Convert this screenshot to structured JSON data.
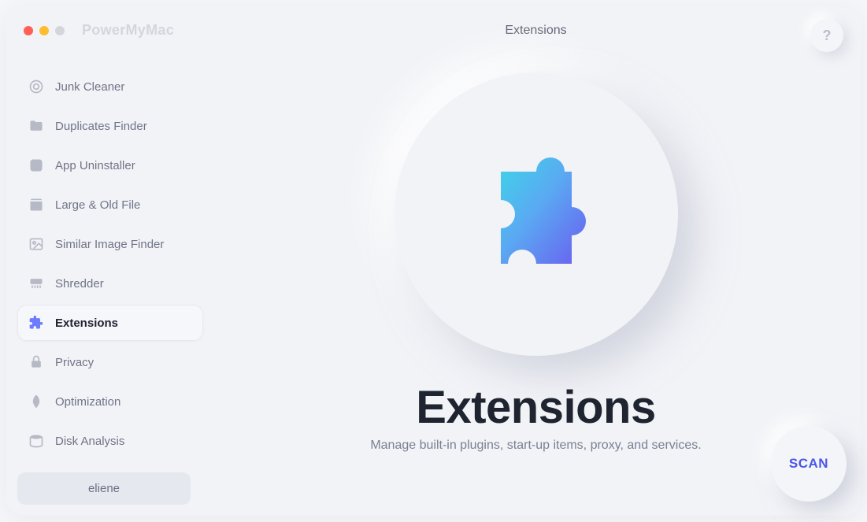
{
  "app": {
    "title": "PowerMyMac"
  },
  "sidebar": {
    "items": [
      {
        "label": "Junk Cleaner"
      },
      {
        "label": "Duplicates Finder"
      },
      {
        "label": "App Uninstaller"
      },
      {
        "label": "Large & Old File"
      },
      {
        "label": "Similar Image Finder"
      },
      {
        "label": "Shredder"
      },
      {
        "label": "Extensions"
      },
      {
        "label": "Privacy"
      },
      {
        "label": "Optimization"
      },
      {
        "label": "Disk Analysis"
      }
    ],
    "user": "eliene"
  },
  "header": {
    "title": "Extensions",
    "help": "?"
  },
  "hero": {
    "title": "Extensions",
    "subtitle": "Manage built-in plugins, start-up items, proxy, and services."
  },
  "actions": {
    "scan": "SCAN"
  }
}
